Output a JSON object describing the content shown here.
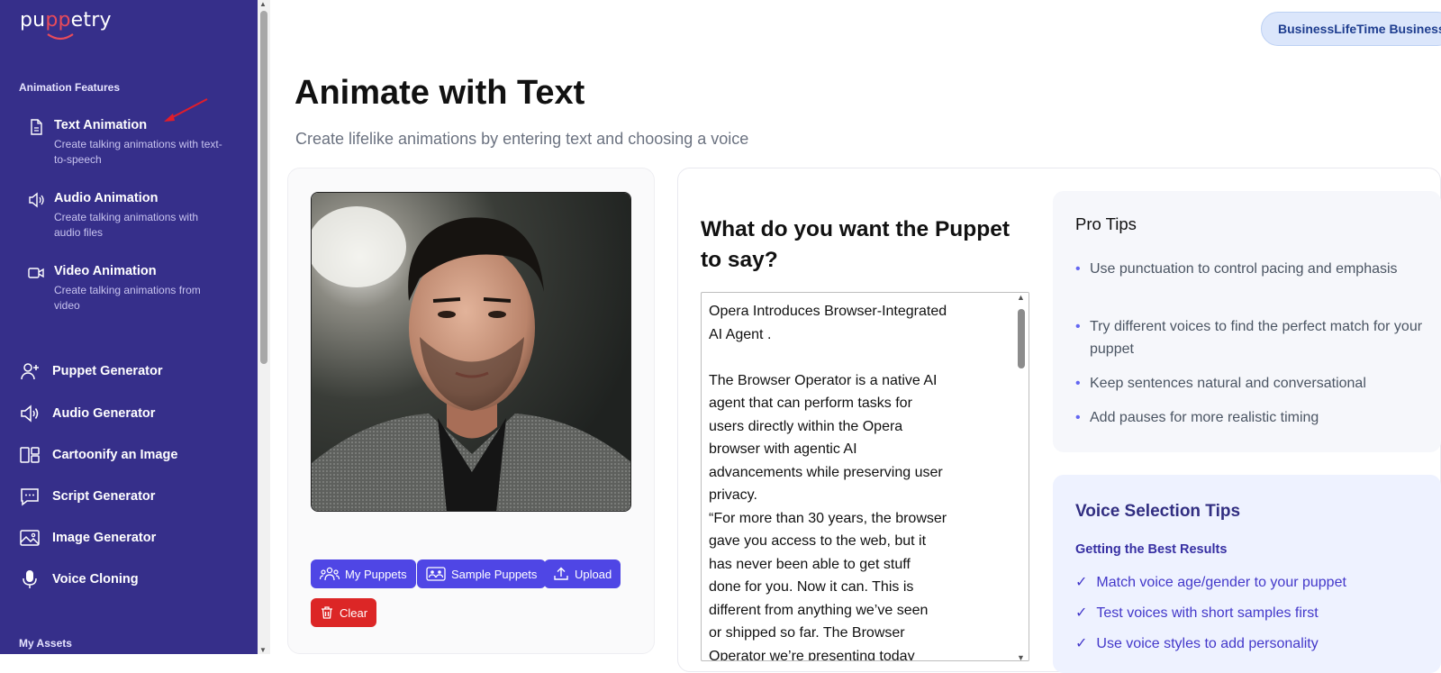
{
  "app": {
    "logo_text_a": "pu",
    "logo_text_b": "pp",
    "logo_text_c": "etry"
  },
  "sidebar": {
    "features_label": "Animation Features",
    "features": [
      {
        "icon": "document-icon",
        "title": "Text Animation",
        "desc": "Create talking animations with text-to-speech"
      },
      {
        "icon": "speaker-icon",
        "title": "Audio Animation",
        "desc": "Create talking animations with audio files"
      },
      {
        "icon": "video-camera-icon",
        "title": "Video Animation",
        "desc": "Create talking animations from video"
      }
    ],
    "nav": [
      {
        "icon": "user-plus-icon",
        "label": "Puppet Generator"
      },
      {
        "icon": "speaker-icon",
        "label": "Audio Generator"
      },
      {
        "icon": "layout-icon",
        "label": "Cartoonify an Image"
      },
      {
        "icon": "chat-bubble-icon",
        "label": "Script Generator"
      },
      {
        "icon": "image-icon",
        "label": "Image Generator"
      },
      {
        "icon": "microphone-icon",
        "label": "Voice Cloning"
      }
    ],
    "assets_label": "My Assets"
  },
  "header": {
    "plan_label": "BusinessLifeTime Business"
  },
  "main": {
    "title": "Animate with Text",
    "subtitle": "Create lifelike animations by entering text and choosing a voice"
  },
  "puppet_panel": {
    "buttons": {
      "my_puppets": "My Puppets",
      "sample_puppets": "Sample Puppets",
      "upload": "Upload",
      "clear": "Clear"
    }
  },
  "script_panel": {
    "prompt_title": "What do you want the Puppet to say?",
    "text_value": "Opera Introduces Browser-Integrated\nAI Agent .\n\nThe Browser Operator is a native AI\nagent that can perform tasks for\nusers directly within the Opera\nbrowser with agentic AI\nadvancements while preserving user\nprivacy.\n“For more than 30 years, the browser\ngave you access to the web, but it\nhas never been able to get stuff\ndone for you. Now it can. This is\ndifferent from anything we’ve seen\nor shipped so far. The Browser\nOperator we’re presenting today"
  },
  "pro_tips": {
    "title": "Pro Tips",
    "items": [
      "Use punctuation to control pacing and emphasis",
      "Try different voices to find the perfect match for your puppet",
      "Keep sentences natural and conversational",
      "Add pauses for more realistic timing"
    ]
  },
  "voice_tips": {
    "title": "Voice Selection Tips",
    "subtitle": "Getting the Best Results",
    "items": [
      "Match voice age/gender to your puppet",
      "Test voices with short samples first",
      "Use voice styles to add personality"
    ]
  },
  "colors": {
    "sidebar_bg": "#362f8a",
    "accent": "#4f46e5",
    "danger": "#dc2626",
    "logo_accent": "#e84b5a"
  }
}
